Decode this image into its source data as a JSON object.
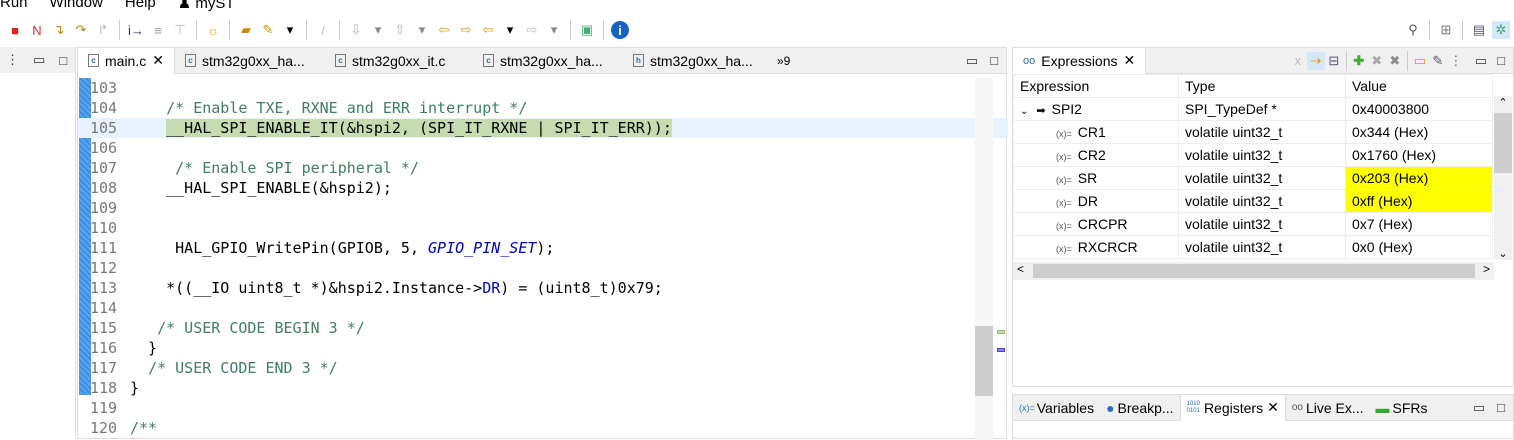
{
  "menu": [
    "Run",
    "Window",
    "Help",
    "myST"
  ],
  "left_tabs": {
    "active": "main.c",
    "tabs": [
      "main.c",
      "stm32g0xx_ha...",
      "stm32g0xx_it.c",
      "stm32g0xx_ha...",
      "stm32g0xx_ha..."
    ],
    "overflow": "»9"
  },
  "code": [
    {
      "n": "103",
      "segs": []
    },
    {
      "n": "104",
      "segs": [
        {
          "t": "    "
        },
        {
          "t": "/* Enable TXE, RXNE and ERR interrupt */",
          "c": "cm"
        }
      ]
    },
    {
      "n": "105",
      "current": true,
      "segs": [
        {
          "t": "    "
        },
        {
          "t": "__HAL_SPI_ENABLE_IT(&hspi2, (SPI_IT_RXNE | SPI_IT_ERR));",
          "c": "hl"
        }
      ]
    },
    {
      "n": "106",
      "segs": []
    },
    {
      "n": "107",
      "segs": [
        {
          "t": "     "
        },
        {
          "t": "/* Enable SPI peripheral */",
          "c": "cm"
        }
      ]
    },
    {
      "n": "108",
      "segs": [
        {
          "t": "    __HAL_SPI_ENABLE(&hspi2);"
        }
      ]
    },
    {
      "n": "109",
      "segs": []
    },
    {
      "n": "110",
      "segs": []
    },
    {
      "n": "111",
      "segs": [
        {
          "t": "     HAL_GPIO_WritePin(GPIOB, 5, "
        },
        {
          "t": "GPIO_PIN_SET",
          "c": "mac"
        },
        {
          "t": ");"
        }
      ]
    },
    {
      "n": "112",
      "segs": []
    },
    {
      "n": "113",
      "segs": [
        {
          "t": "    *((__IO uint8_t *)&hspi2.Instance->"
        },
        {
          "t": "DR",
          "c": "fld"
        },
        {
          "t": ") = (uint8_t)0x79;"
        }
      ]
    },
    {
      "n": "114",
      "segs": []
    },
    {
      "n": "115",
      "segs": [
        {
          "t": "   "
        },
        {
          "t": "/* USER CODE BEGIN 3 */",
          "c": "cm"
        }
      ]
    },
    {
      "n": "116",
      "segs": [
        {
          "t": "  }"
        }
      ]
    },
    {
      "n": "117",
      "segs": [
        {
          "t": "  "
        },
        {
          "t": "/* USER CODE END 3 */",
          "c": "cm"
        }
      ]
    },
    {
      "n": "118",
      "segs": [
        {
          "t": "}"
        }
      ]
    },
    {
      "n": "119",
      "segs": []
    },
    {
      "n": "120",
      "segs": [
        {
          "t": "/**",
          "c": "cm"
        }
      ]
    }
  ],
  "expressions": {
    "tab": "Expressions",
    "headers": [
      "Expression",
      "Type",
      "Value"
    ],
    "rows": [
      {
        "name": "SPI2",
        "type": "SPI_TypeDef *",
        "value": "0x40003800",
        "parent": true
      },
      {
        "name": "CR1",
        "type": "volatile uint32_t",
        "value": "0x344 (Hex)"
      },
      {
        "name": "CR2",
        "type": "volatile uint32_t",
        "value": "0x1760 (Hex)"
      },
      {
        "name": "SR",
        "type": "volatile uint32_t",
        "value": "0x203 (Hex)",
        "changed": true
      },
      {
        "name": "DR",
        "type": "volatile uint32_t",
        "value": "0xff (Hex)",
        "changed": true
      },
      {
        "name": "CRCPR",
        "type": "volatile uint32_t",
        "value": "0x7 (Hex)"
      },
      {
        "name": "RXCRCR",
        "type": "volatile uint32_t",
        "value": "0x0 (Hex)"
      }
    ]
  },
  "bottom_tabs": {
    "active": "Registers",
    "tabs": [
      "Variables",
      "Breakp...",
      "Registers",
      "Live Ex...",
      "SFRs"
    ]
  }
}
